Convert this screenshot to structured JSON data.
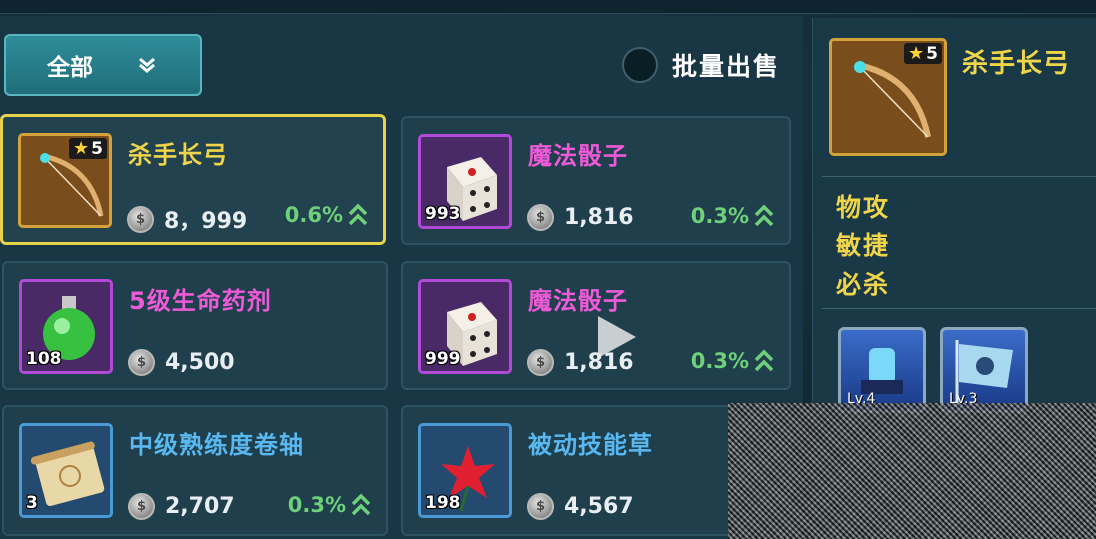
{
  "filter": {
    "label": "全部"
  },
  "bulk_sell": {
    "label": "批量出售",
    "checked": false
  },
  "items": [
    {
      "name": "杀手长弓",
      "price": "8，999",
      "rate": "0.6%",
      "stars": "5",
      "qty": "",
      "rarity": "gold",
      "icon": "bow-icon",
      "selected": true
    },
    {
      "name": "魔法骰子",
      "price": "1,816",
      "rate": "0.3%",
      "stars": "",
      "qty": "993",
      "rarity": "purple",
      "icon": "dice-icon",
      "selected": false
    },
    {
      "name": "5级生命药剂",
      "price": "4,500",
      "rate": "",
      "stars": "",
      "qty": "108",
      "rarity": "purple",
      "icon": "potion-icon",
      "selected": false
    },
    {
      "name": "魔法骰子",
      "price": "1,816",
      "rate": "0.3%",
      "stars": "",
      "qty": "999",
      "rarity": "purple",
      "icon": "dice-icon",
      "selected": false
    },
    {
      "name": "中级熟练度卷轴",
      "price": "2,707",
      "rate": "0.3%",
      "stars": "",
      "qty": "3",
      "rarity": "blue",
      "icon": "scroll-icon",
      "selected": false
    },
    {
      "name": "被动技能草",
      "price": "4,567",
      "rate": "",
      "stars": "",
      "qty": "198",
      "rarity": "blue",
      "icon": "herb-icon",
      "selected": false
    }
  ],
  "detail": {
    "name": "杀手长弓",
    "stars": "5",
    "stats": [
      "物攻",
      "敏捷",
      "必杀"
    ],
    "skills": [
      {
        "level": "Lv.4",
        "icon": "armor-skill-icon"
      },
      {
        "level": "Lv.3",
        "icon": "banner-skill-icon"
      }
    ]
  },
  "colors": {
    "gold": "#f0d44a",
    "purple": "#ee5ad8",
    "blue": "#5ab8f0",
    "rate_green": "#6fd07a",
    "filter_teal": "#2f8d9a"
  }
}
